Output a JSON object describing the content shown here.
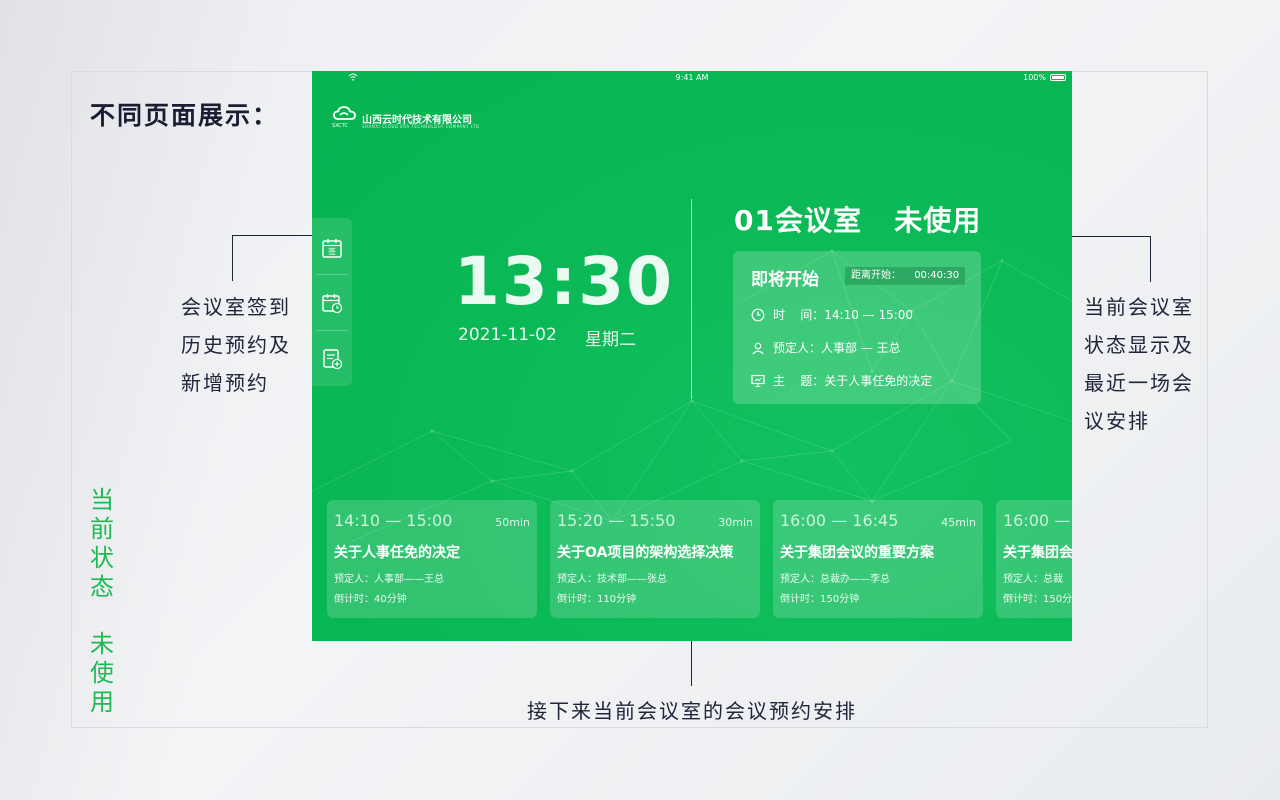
{
  "page": {
    "title": "不同页面展示：",
    "left_label_lines": [
      "会议室签到",
      "历史预约及",
      "新增预约"
    ],
    "right_label_lines": [
      "当前会议室",
      "状态显示及",
      "最近一场会",
      "议安排"
    ],
    "bottom_label": "接下来当前会议室的会议预约安排",
    "vertical_status_top": [
      "当",
      "前",
      "状",
      "态"
    ],
    "vertical_status_bottom": [
      "未",
      "使",
      "用"
    ],
    "accent_green": "#1db954"
  },
  "screen": {
    "statusbar": {
      "time": "9:41 AM",
      "battery": "100%"
    },
    "logo": {
      "name": "山西云时代技术有限公司",
      "sub": "SHANXI CLOUD ERA TECHNOLOGY COMPANY LTD.",
      "abbr": "SXCTC"
    },
    "toolbar": [
      {
        "name": "sign-in",
        "glyph": "签"
      },
      {
        "name": "history"
      },
      {
        "name": "new-booking"
      }
    ],
    "clock": {
      "time": "13:30",
      "date": "2021-11-02",
      "weekday": "星期二"
    },
    "room": {
      "title": "01会议室   未使用"
    },
    "next_meeting": {
      "heading": "即将开始",
      "countdown_label": "距离开始：",
      "countdown_value": "00:40:30",
      "time_row": "时    间：14:10 — 15:00",
      "booker_row": "预定人：人事部 — 王总",
      "topic_row": "主    题：关于人事任免的决定"
    },
    "schedule": [
      {
        "time": "14:10 — 15:00",
        "duration": "50min",
        "topic": "关于人事任免的决定",
        "booker": "预定人：人事部——王总",
        "countdown": "倒计时：40分钟"
      },
      {
        "time": "15:20 — 15:50",
        "duration": "30min",
        "topic": "关于OA项目的架构选择决策",
        "booker": "预定人：技术部——张总",
        "countdown": "倒计时：110分钟"
      },
      {
        "time": "16:00 — 16:45",
        "duration": "45min",
        "topic": "关于集团会议的重要方案",
        "booker": "预定人：总裁办——李总",
        "countdown": "倒计时：150分钟"
      },
      {
        "time": "16:00 — 1",
        "duration": "",
        "topic": "关于集团会",
        "booker": "预定人：总裁",
        "countdown": "倒计时：150分"
      }
    ]
  }
}
